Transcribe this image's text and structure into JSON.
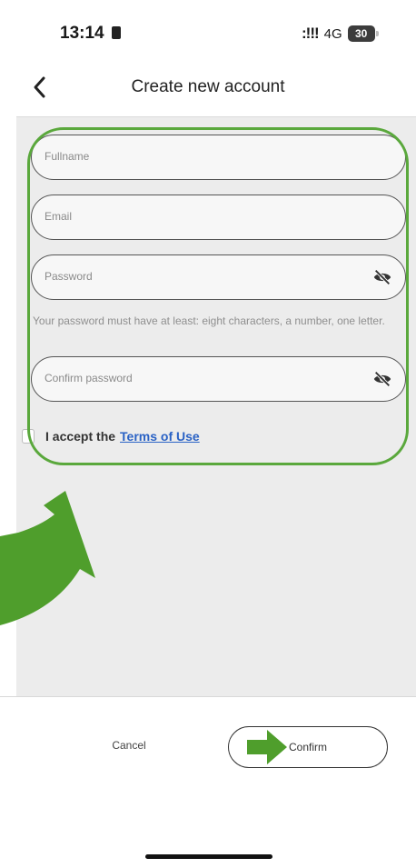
{
  "status_bar": {
    "time": "13:14",
    "network": "4G",
    "battery": "30"
  },
  "nav": {
    "title": "Create new account",
    "back_icon": "chevron-left-icon"
  },
  "form": {
    "fullname": {
      "placeholder": "Fullname",
      "value": ""
    },
    "email": {
      "placeholder": "Email",
      "value": ""
    },
    "password": {
      "placeholder": "Password",
      "value": "",
      "icon": "eye-off-icon"
    },
    "password_hint": "Your password must have at least: eight characters, a number, one letter.",
    "confirm_password": {
      "placeholder": "Confirm password",
      "value": "",
      "icon": "eye-off-icon"
    },
    "terms": {
      "prefix": "I accept the",
      "link": "Terms of Use",
      "checked": false
    }
  },
  "actions": {
    "cancel_label": "Cancel",
    "confirm_label": "Confirm"
  },
  "annotation_colors": {
    "highlight": "#5aa83c",
    "arrow": "#4f9e2c"
  }
}
